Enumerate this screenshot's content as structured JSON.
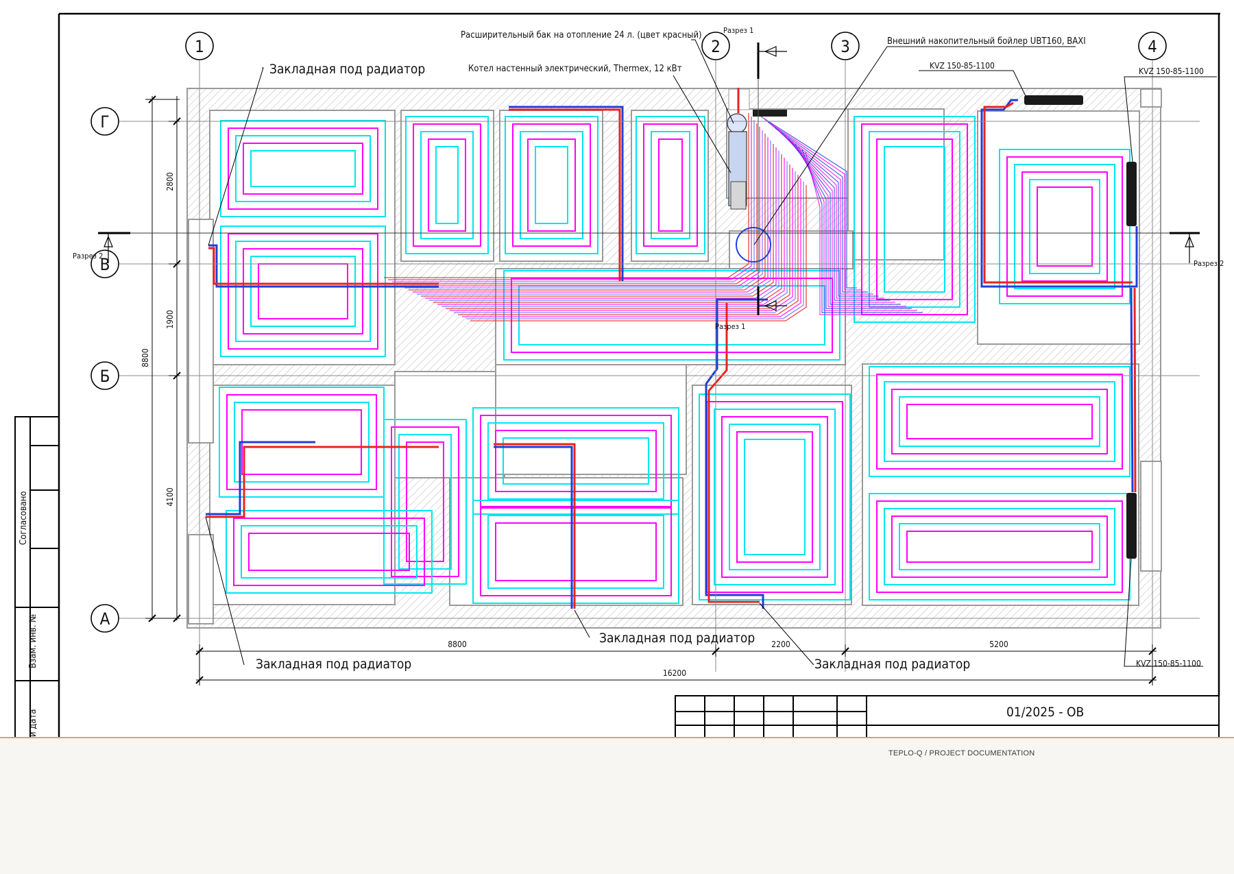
{
  "drawing": {
    "axes": {
      "columns": [
        "1",
        "2",
        "3",
        "4"
      ],
      "rows": [
        "Г",
        "В",
        "Б",
        "А"
      ]
    },
    "dimensions": {
      "horizontal": [
        "8800",
        "2200",
        "5200",
        "16200"
      ],
      "vertical": [
        "2800",
        "1900",
        "4100",
        "8800"
      ]
    },
    "callouts": {
      "expansion_tank": "Расширительный бак на отопление 24 л. (цвет красный)",
      "boiler": "Котел настенный электрический, Thermex, 12 кВт",
      "storage_heater": "Внешний накопительный бойлер UBT160, BAXI",
      "radiator_top_right": "KVZ 150-85-1100",
      "radiator_right_upper": "KVZ 150-85-1100",
      "radiator_right_lower": "KVZ 150-85-1100",
      "embed_radiator_top_left": "Закладная под радиатор",
      "embed_radiator_bottom_left": "Закладная под радиатор",
      "embed_radiator_bottom_mid": "Закладная под радиатор",
      "embed_radiator_bottom_right": "Закладная под радиатор"
    },
    "sections": {
      "section1_top": "Разрез 1",
      "section1_bottom": "Разрез 1",
      "section2_left": "Разрез 2",
      "section2_right": "Разрез 2"
    },
    "side_stamp": {
      "agreed": "Согласовано",
      "inv_no": "Взам. инв. №",
      "date": "и дата"
    },
    "title_block": {
      "doc_code": "01/2025 - ОВ"
    },
    "colors": {
      "loop_a": "#ff00ff",
      "loop_b": "#00e5ee",
      "supply": "#e8231f",
      "return": "#1f3fd6",
      "walls": "#9a9a9a",
      "frame": "#000000"
    }
  },
  "footer": {
    "text": "TEPLO-Q / PROJECT DOCUMENTATION"
  }
}
